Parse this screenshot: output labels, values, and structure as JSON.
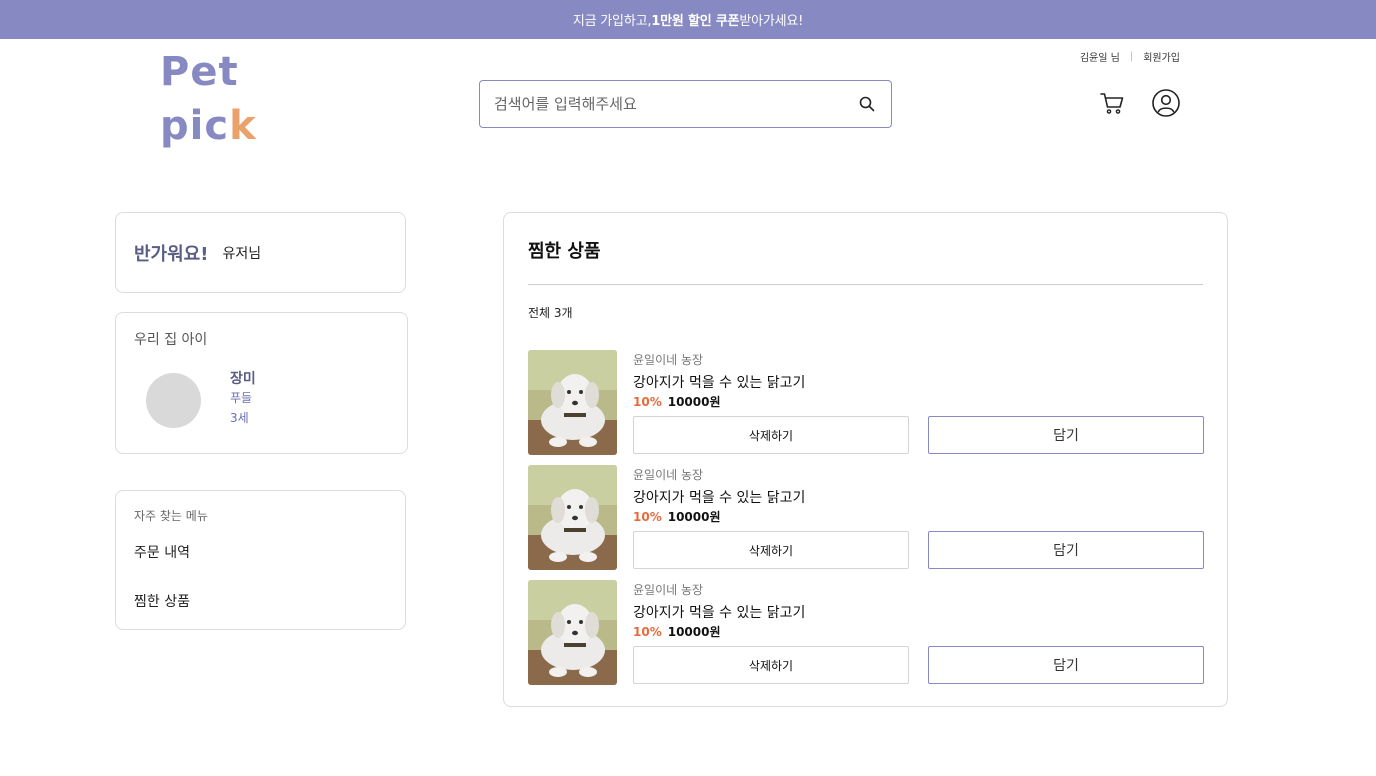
{
  "banner": {
    "prefix": "지금 가입하고, ",
    "highlight": "1만원 할인 쿠폰",
    "suffix": " 받아가세요!"
  },
  "logo": {
    "line1": "Pet",
    "line2_main": "pic",
    "line2_accent": "k"
  },
  "search": {
    "placeholder": "검색어를 입력해주세요",
    "icon": "search-icon"
  },
  "top_links": {
    "user": "김윤일 님",
    "separator": "|",
    "signup": "회원가입"
  },
  "header_icons": [
    "cart-icon",
    "user-icon"
  ],
  "greeting": {
    "hello": "반가워요!",
    "user": "유저님"
  },
  "pet_card": {
    "title": "우리 집 아이",
    "name": "장미",
    "breed": "푸들",
    "age": "3세"
  },
  "menu_card": {
    "title": "자주 찾는 메뉴",
    "items": [
      "주문 내역",
      "찜한 상품"
    ]
  },
  "wishlist": {
    "title": "찜한 상품",
    "count": "전체 3개",
    "items": [
      {
        "shop": "윤일이네 농장",
        "name": "강아지가 먹을 수 있는 닭고기",
        "discount": "10%",
        "price": "10000원",
        "delete_label": "삭제하기",
        "cart_label": "담기"
      },
      {
        "shop": "윤일이네 농장",
        "name": "강아지가 먹을 수 있는 닭고기",
        "discount": "10%",
        "price": "10000원",
        "delete_label": "삭제하기",
        "cart_label": "담기"
      },
      {
        "shop": "윤일이네 농장",
        "name": "강아지가 먹을 수 있는 닭고기",
        "discount": "10%",
        "price": "10000원",
        "delete_label": "삭제하기",
        "cart_label": "담기"
      }
    ]
  },
  "colors": {
    "brand": "#8789c3",
    "discount": "#e86a3c",
    "logo_accent": "#e9a26c"
  }
}
